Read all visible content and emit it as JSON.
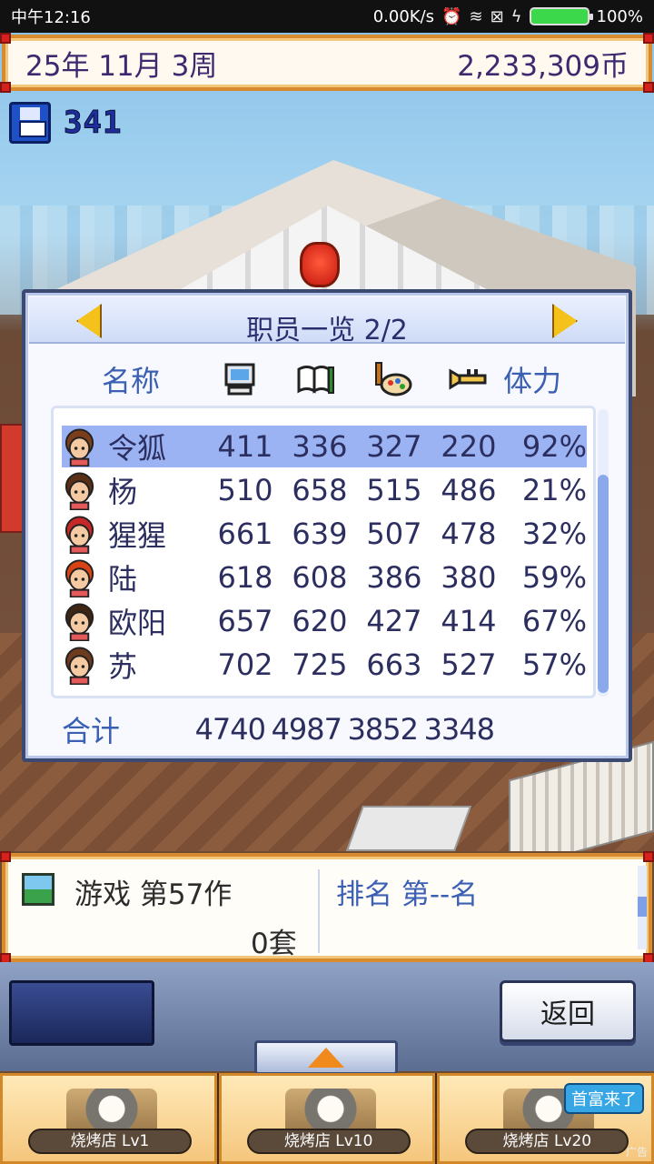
{
  "status_bar": {
    "time": "中午12:16",
    "network_speed": "0.00K/s",
    "battery": "100%"
  },
  "top_bar": {
    "date": "25年 11月 3周",
    "money": "2,233,309币"
  },
  "save_count": "341",
  "staff_panel": {
    "title": "职员一览 2/2",
    "columns": {
      "name": "名称",
      "programming_icon": "computer-icon",
      "scenario_icon": "book-pen-icon",
      "graphics_icon": "palette-brush-icon",
      "sound_icon": "trumpet-icon",
      "stamina": "体力"
    },
    "staff": [
      {
        "name": "令狐",
        "stats": [
          "411",
          "336",
          "327",
          "220"
        ],
        "stamina": "92%",
        "selected": true
      },
      {
        "name": "杨",
        "stats": [
          "510",
          "658",
          "515",
          "486"
        ],
        "stamina": "21%"
      },
      {
        "name": "猩猩",
        "stats": [
          "661",
          "639",
          "507",
          "478"
        ],
        "stamina": "32%"
      },
      {
        "name": "陆",
        "stats": [
          "618",
          "608",
          "386",
          "380"
        ],
        "stamina": "59%"
      },
      {
        "name": "欧阳",
        "stats": [
          "657",
          "620",
          "427",
          "414"
        ],
        "stamina": "67%"
      },
      {
        "name": "苏",
        "stats": [
          "702",
          "725",
          "663",
          "527"
        ],
        "stamina": "57%"
      }
    ],
    "total_label": "合计",
    "totals": [
      "4740",
      "4987",
      "3852",
      "3348"
    ]
  },
  "game_info": {
    "title": "游戏 第57作",
    "sales": "0套",
    "rank": "排名 第--名"
  },
  "controls": {
    "back_label": "返回"
  },
  "ads": [
    {
      "label": "烧烤店 Lv1"
    },
    {
      "label": "烧烤店 Lv10"
    },
    {
      "label": "烧烤店 Lv20",
      "badge": "首富来了"
    }
  ],
  "ad_tag": "广告",
  "colors": {
    "frame_orange": "#d88a2e",
    "panel_blue": "#3a5fb3",
    "selected_row": "#9bb3f3"
  }
}
